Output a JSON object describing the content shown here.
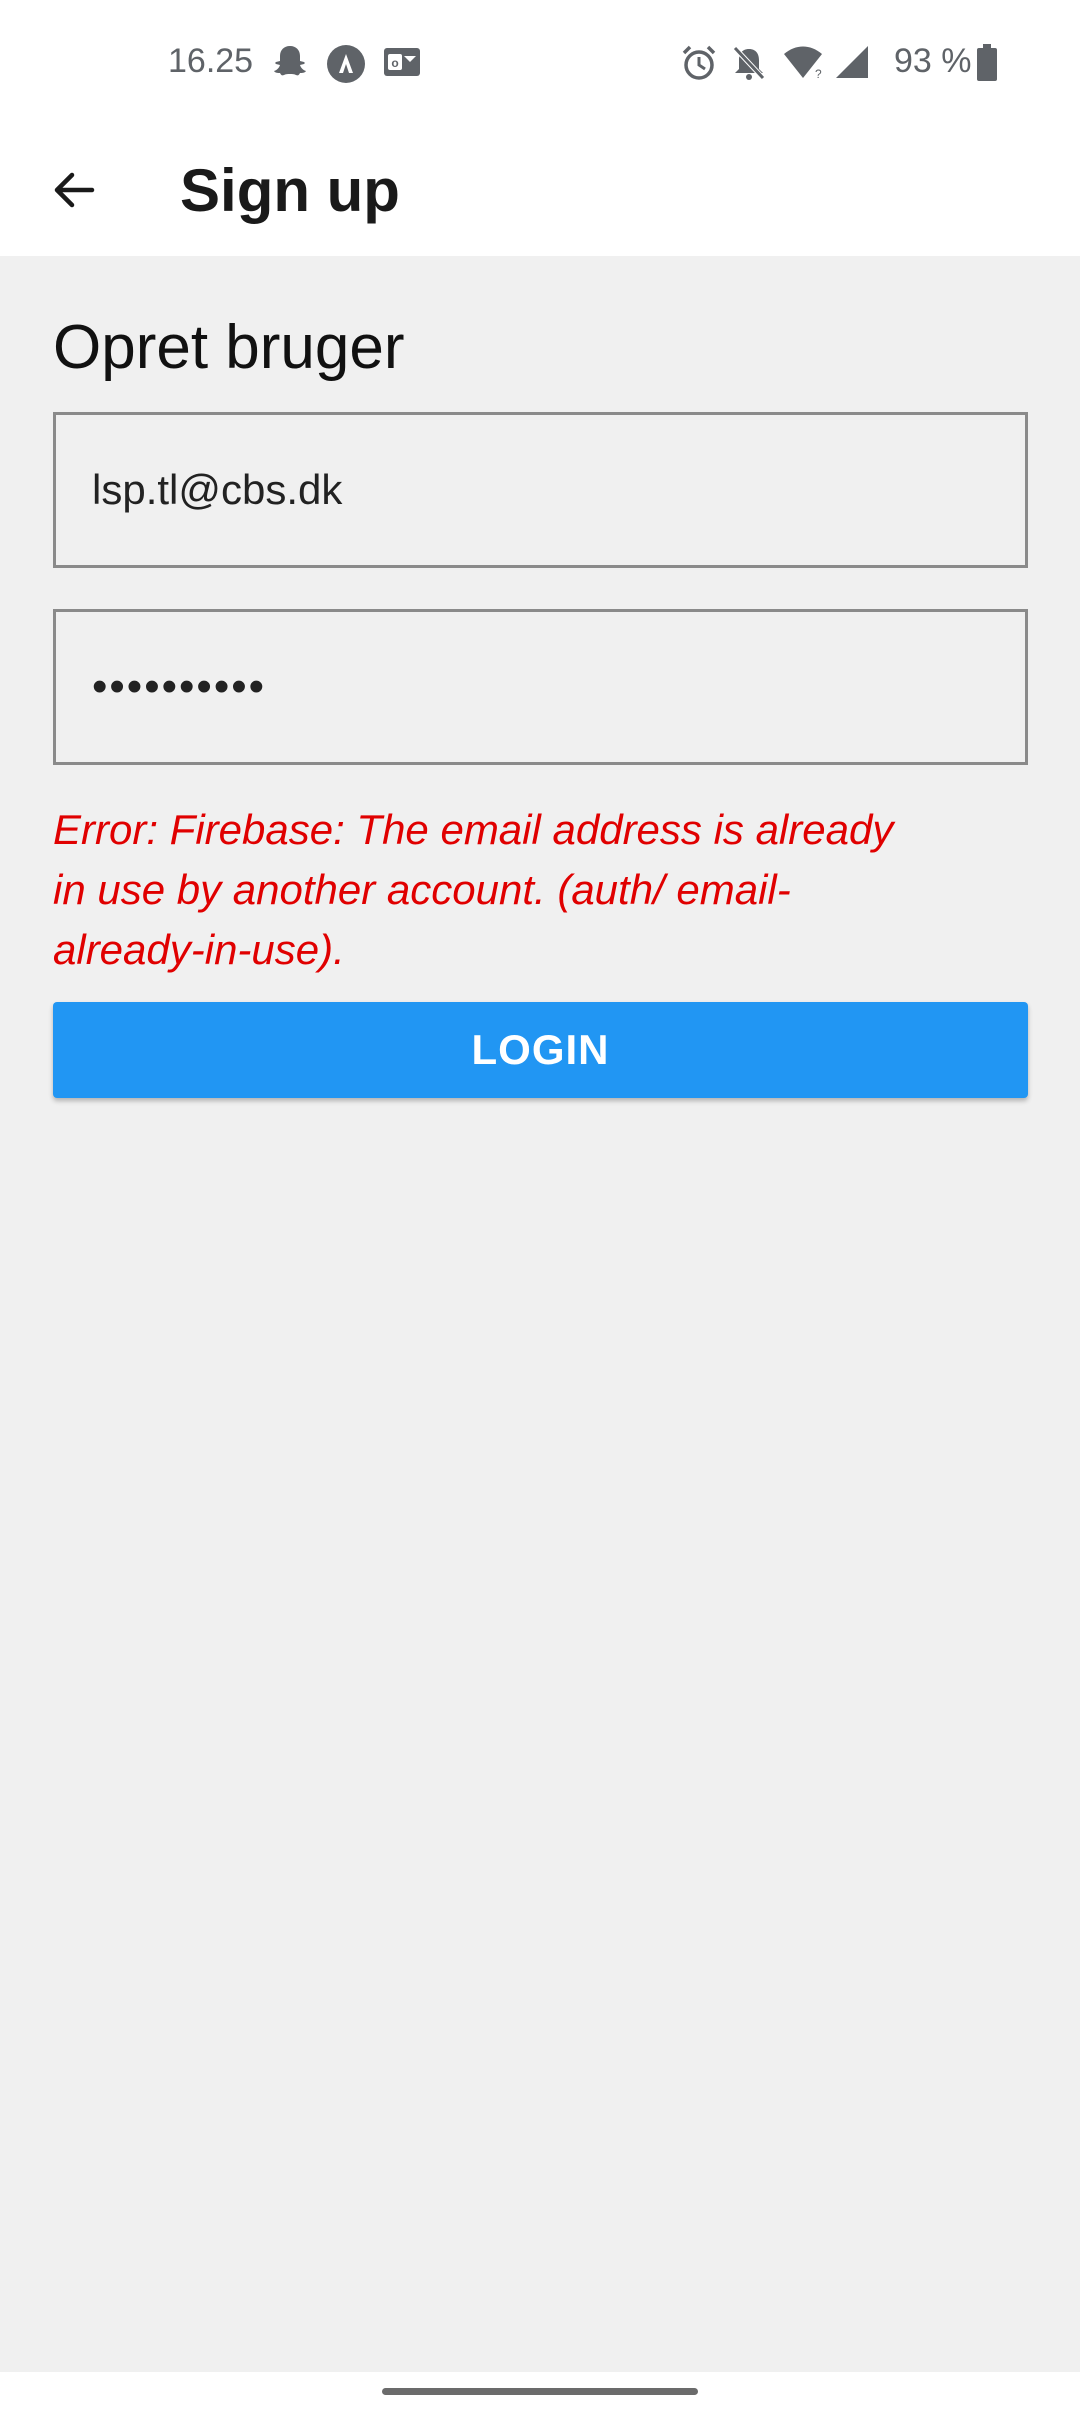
{
  "status_bar": {
    "time": "16.25",
    "battery": "93 %",
    "left_icons": [
      "snapchat-icon",
      "navigation-icon",
      "outlook-icon"
    ],
    "right_icons": [
      "alarm-icon",
      "silent-bell-icon",
      "wifi-icon",
      "signal-icon",
      "battery-icon"
    ]
  },
  "app_bar": {
    "title": "Sign up",
    "back_icon": "arrow-left-icon"
  },
  "form": {
    "heading": "Opret bruger",
    "email_value": "lsp.tl@cbs.dk",
    "password_value": "••••••••••",
    "error": "Error: Firebase: The email address is already in use by another account. (auth/ email-already-in-use).",
    "login_label": "LOGIN"
  },
  "colors": {
    "accent": "#2196f3",
    "error": "#e00000",
    "background": "#f0f0f0"
  }
}
